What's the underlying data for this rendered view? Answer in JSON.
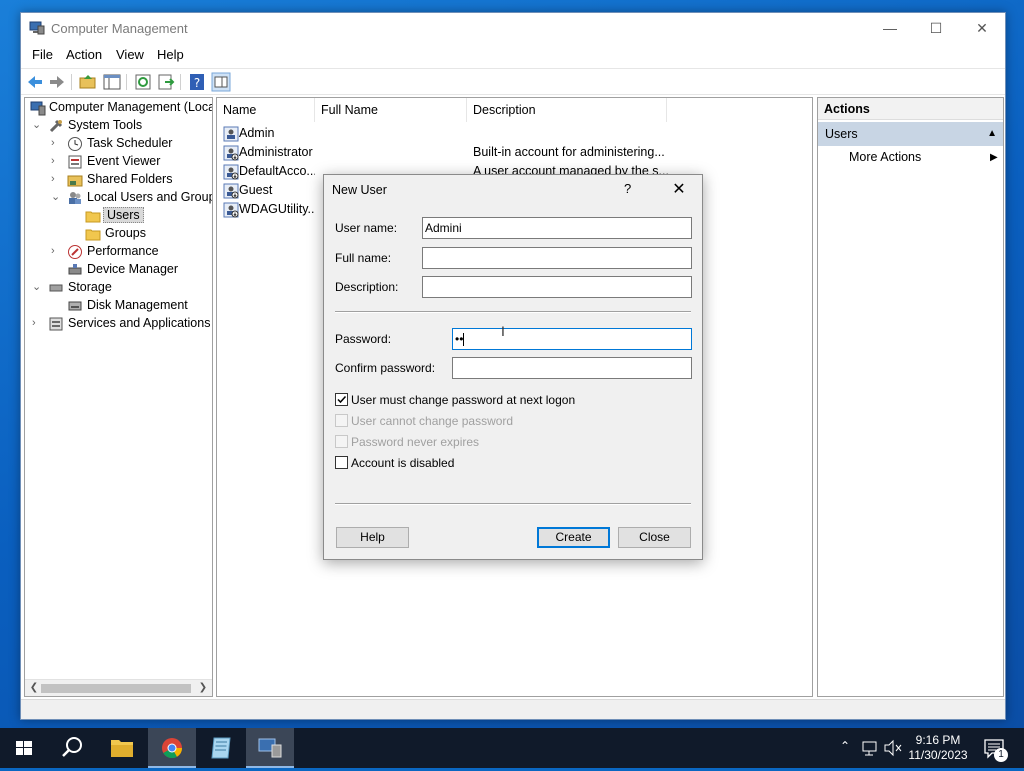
{
  "window": {
    "title": "Computer Management"
  },
  "menu": [
    "File",
    "Action",
    "View",
    "Help"
  ],
  "tree": {
    "root": "Computer Management (Local",
    "system_tools": "System Tools",
    "task_scheduler": "Task Scheduler",
    "event_viewer": "Event Viewer",
    "shared_folders": "Shared Folders",
    "local_users": "Local Users and Groups",
    "users": "Users",
    "groups": "Groups",
    "performance": "Performance",
    "device_manager": "Device Manager",
    "storage": "Storage",
    "disk_management": "Disk Management",
    "services": "Services and Applications"
  },
  "list": {
    "columns": [
      "Name",
      "Full Name",
      "Description"
    ],
    "rows": [
      {
        "name": "Admin",
        "full_name": "",
        "description": ""
      },
      {
        "name": "Administrator",
        "full_name": "",
        "description": "Built-in account for administering..."
      },
      {
        "name": "DefaultAcco...",
        "full_name": "",
        "description": "A user account managed by the s..."
      },
      {
        "name": "Guest",
        "full_name": "",
        "description": ""
      },
      {
        "name": "WDAGUtility...",
        "full_name": "",
        "description": ""
      }
    ]
  },
  "actions": {
    "header": "Actions",
    "section": "Users",
    "more": "More Actions"
  },
  "dialog": {
    "title": "New User",
    "help_glyph": "?",
    "username_label": "User name:",
    "username_value": "Admini",
    "fullname_label": "Full name:",
    "fullname_value": "",
    "description_label": "Description:",
    "description_value": "",
    "password_label": "Password:",
    "password_value": "••",
    "confirm_label": "Confirm password:",
    "confirm_value": "",
    "cb_must_change": "User must change password at next logon",
    "cb_cannot_change": "User cannot change password",
    "cb_never_expires": "Password never expires",
    "cb_disabled": "Account is disabled",
    "help_button": "Help",
    "create_button": "Create",
    "close_button": "Close"
  },
  "taskbar": {
    "time": "9:16 PM",
    "date": "11/30/2023",
    "notif_count": "1"
  },
  "colors": {
    "accent": "#0078d7",
    "desktop": "#0a67c2",
    "taskbar": "#101a2a"
  }
}
